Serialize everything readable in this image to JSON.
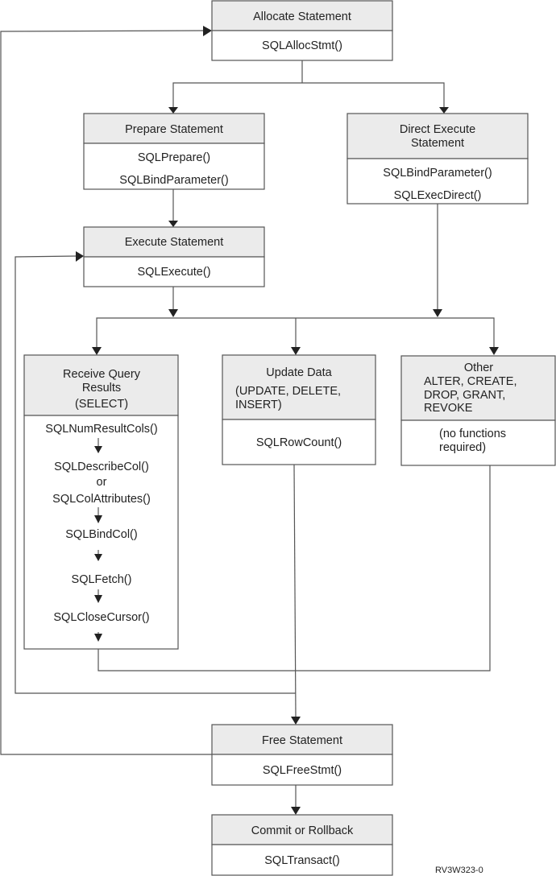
{
  "boxes": {
    "allocate": {
      "title": [
        "Allocate Statement"
      ],
      "functions": [
        "SQLAllocStmt()"
      ]
    },
    "prepare": {
      "title": [
        "Prepare Statement"
      ],
      "functions": [
        "SQLPrepare()",
        "SQLBindParameter()"
      ]
    },
    "direct": {
      "title": [
        "Direct Execute",
        "Statement"
      ],
      "functions": [
        "SQLBindParameter()",
        "SQLExecDirect()"
      ]
    },
    "execute": {
      "title": [
        "Execute Statement"
      ],
      "functions": [
        "SQLExecute()"
      ]
    },
    "receive": {
      "title": [
        "Receive Query",
        "Results",
        "(SELECT)"
      ],
      "functions": [
        "SQLNumResultCols()",
        "SQLDescribeCol()",
        "or",
        "SQLColAttributes()",
        "SQLBindCol()",
        "SQLFetch()",
        "SQLCloseCursor()"
      ]
    },
    "update": {
      "title": [
        "Update Data",
        "(UPDATE, DELETE,",
        "INSERT)"
      ],
      "functions": [
        "SQLRowCount()"
      ]
    },
    "other": {
      "title": [
        "Other",
        "ALTER, CREATE,",
        "DROP, GRANT,",
        "REVOKE"
      ],
      "functions": [
        "(no functions",
        "required)"
      ]
    },
    "free": {
      "title": [
        "Free Statement"
      ],
      "functions": [
        "SQLFreeStmt()"
      ]
    },
    "commit": {
      "title": [
        "Commit or Rollback"
      ],
      "functions": [
        "SQLTransact()"
      ]
    }
  },
  "figure_id": "RV3W323-0",
  "colors": {
    "header_fill": "#ebebeb",
    "line": "#555555"
  }
}
